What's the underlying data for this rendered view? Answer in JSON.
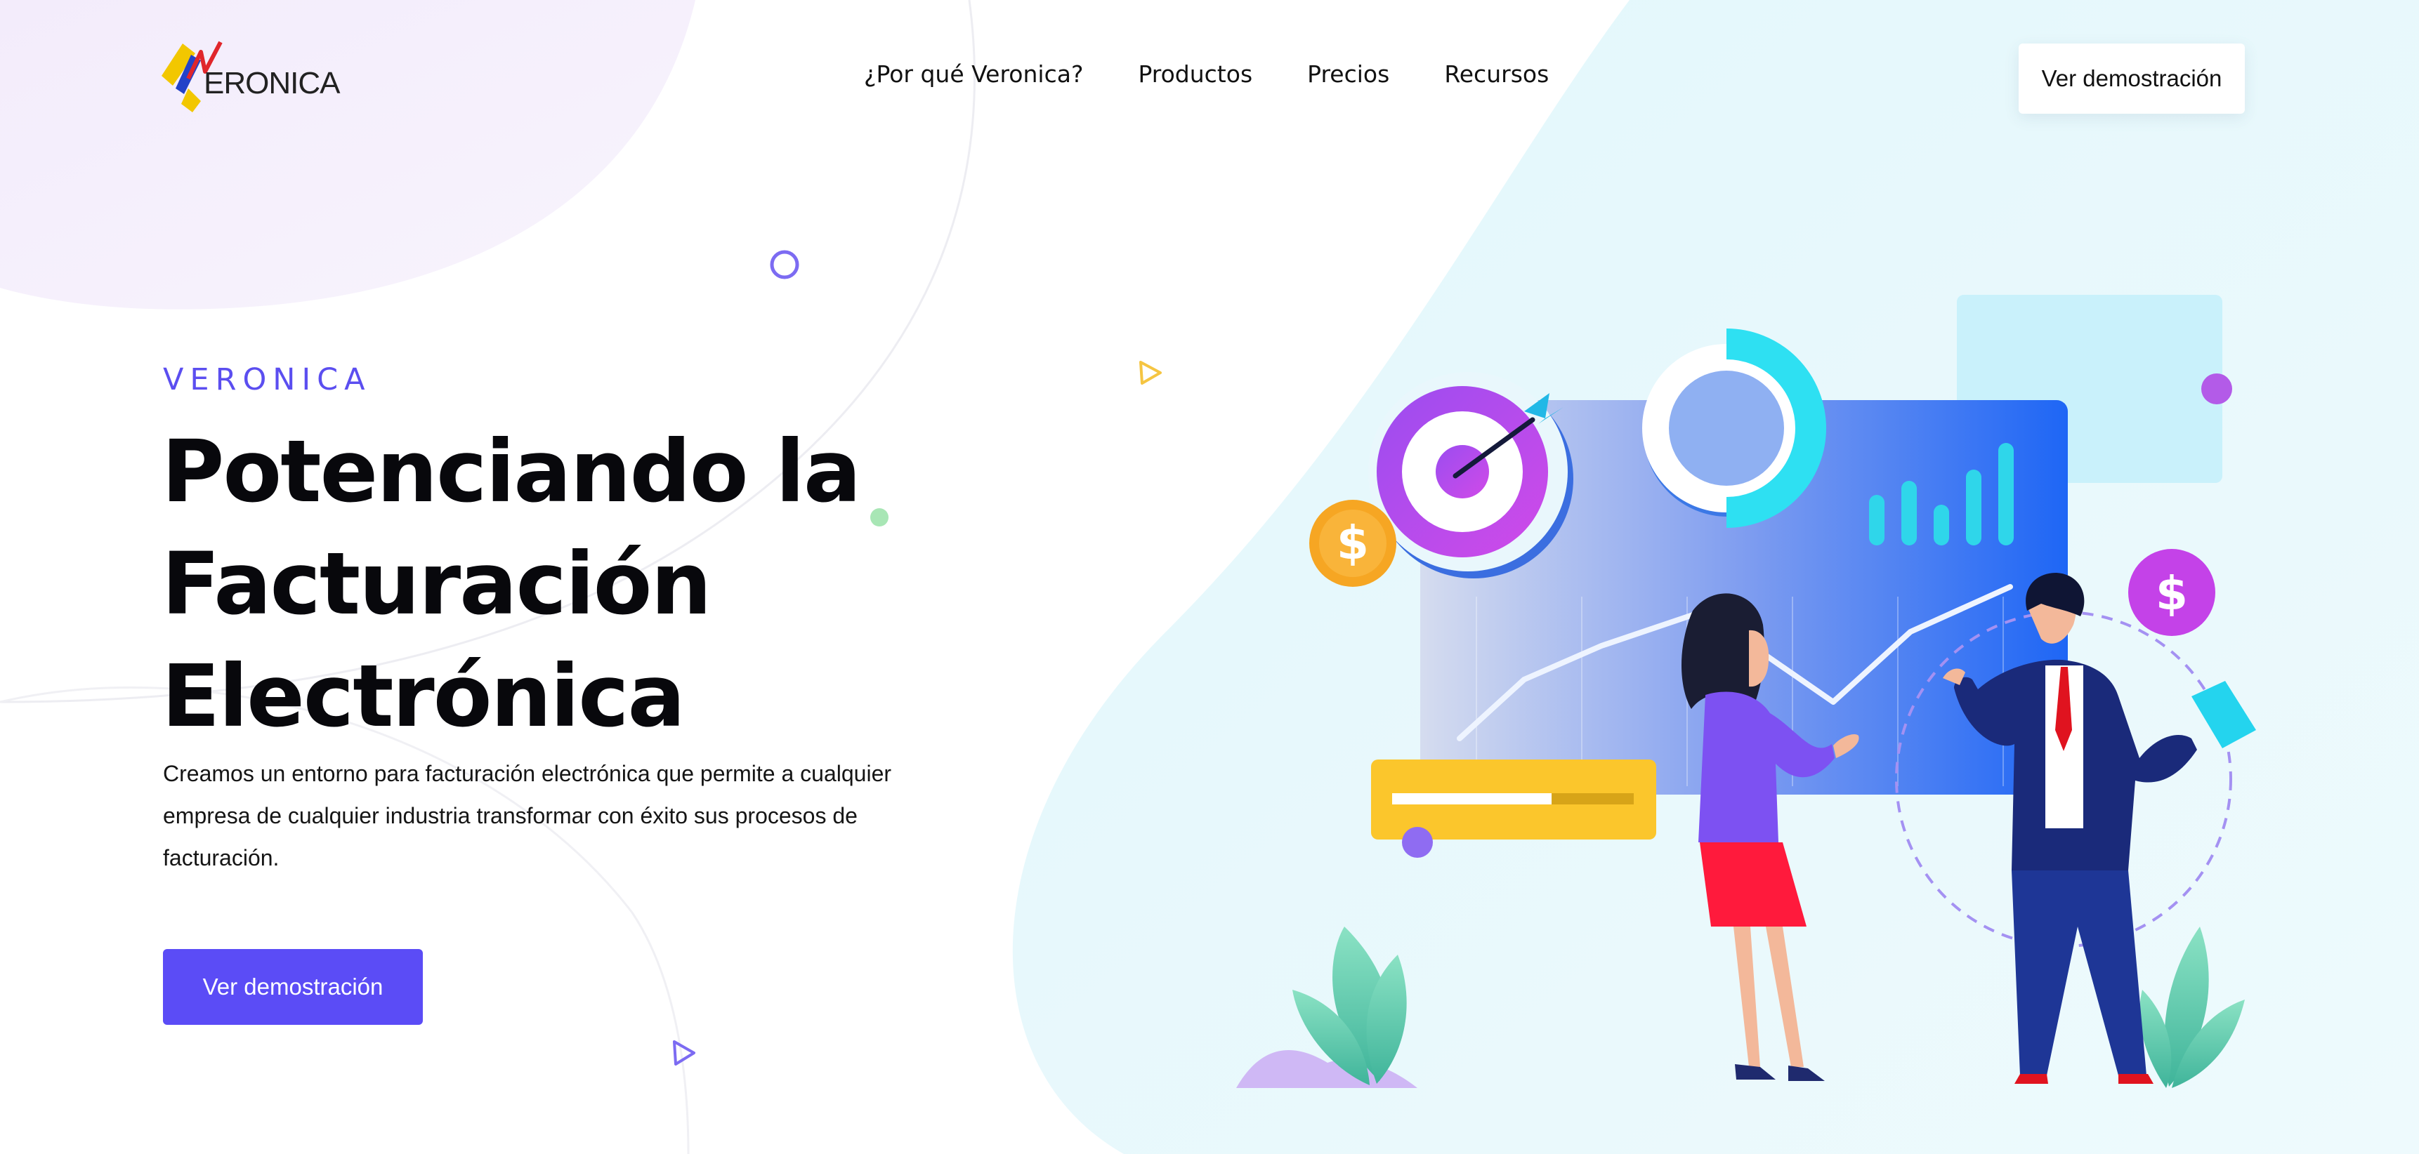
{
  "brand": {
    "name": "ERONICA",
    "colors": {
      "yellow": "#f2c700",
      "blue": "#2342c8",
      "red": "#e0262b"
    }
  },
  "nav": {
    "items": [
      "¿Por qué Veronica?",
      "Productos",
      "Precios",
      "Recursos"
    ],
    "cta_label": "Ver demostración"
  },
  "hero": {
    "eyebrow": "VERONICA",
    "title_lines": [
      "Potenciando la",
      "Facturación",
      "Electrónica"
    ],
    "description": "Creamos un entorno para facturación electrónica que permite a cualquier empresa de cualquier industria transformar con éxito sus procesos de facturación.",
    "cta_label": "Ver demostración"
  },
  "illustration": {
    "currency_symbol": "$",
    "progress_fraction": 0.66,
    "icons": [
      "target-icon",
      "donut-chart-icon",
      "bar-chart-icon",
      "line-chart-icon",
      "dollar-coin-icon",
      "leaf-icon"
    ]
  },
  "colors": {
    "accent": "#5b4cf6",
    "eyebrow": "#5b4ef0",
    "bg_right": "#e6f8fb",
    "bg_left_blob": "#f1ecfb"
  }
}
